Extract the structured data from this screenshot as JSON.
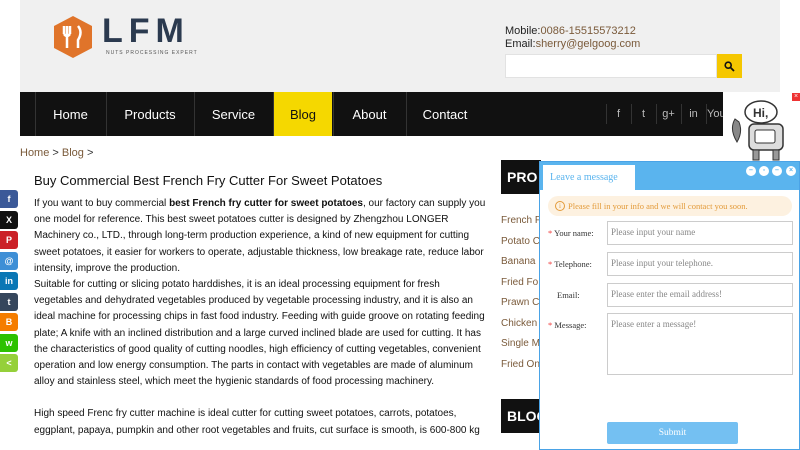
{
  "header": {
    "logo_text": "LFM",
    "logo_sub": "NUTS PROCESSING EXPERT",
    "mobile_label": "Mobile:",
    "mobile_value": "0086-15515573212",
    "email_label": "Email:",
    "email_value": "sherry@gelgoog.com"
  },
  "nav": {
    "items": [
      {
        "label": "Home"
      },
      {
        "label": "Products"
      },
      {
        "label": "Service"
      },
      {
        "label": "Blog"
      },
      {
        "label": "About"
      },
      {
        "label": "Contact"
      }
    ],
    "active": "Blog",
    "social": [
      "f",
      "t",
      "g+",
      "in",
      "You"
    ]
  },
  "breadcrumb": {
    "home": "Home",
    "sep1": " > ",
    "blog": "Blog",
    "sep2": " >"
  },
  "article": {
    "title": "Buy Commercial Best French Fry Cutter For Sweet Potatoes",
    "p1_before": "If you want to buy commercial ",
    "p1_bold": "best French fry cutter for sweet potatoes",
    "p1_after": ", our factory can supply you one model for reference. This best sweet potatoes cutter is designed by Zhengzhou LONGER Machinery co., LTD., through long-term production experience, a kind of new equipment for cutting sweet potatoes, it easier for workers to operate, adjustable thickness, low breakage rate, reduce labor intensity, improve the production.",
    "p2": "Suitable for cutting or slicing potato harddishes, it is an ideal processing equipment for fresh vegetables and dehydrated vegetables produced by vegetable processing industry, and it is also an ideal machine for processing chips in fast food industry. Feeding with guide groove on rotating feeding plate; A knife with an inclined distribution and a large curved inclined blade are used for cutting. It has the characteristics of good quality of cutting noodles, high efficiency of cutting vegetables, convenient operation and low energy consumption. The parts in contact with vegetables are made of aluminum alloy and stainless steel, which meet the hygienic standards of food processing machinery.",
    "p3": "High speed Frenc fry cutter machine is ideal cutter for cutting sweet potatoes, carrots, potatoes, eggplant, papaya, pumpkin and other root vegetables and fruits, cut surface is smooth, is 600-800 kg"
  },
  "sidebar": {
    "products_head": "PRO",
    "items": [
      "French F",
      "Potato C",
      "Banana",
      "Fried Fo",
      "Prawn C",
      "Chicken",
      "Single M",
      "Fried On"
    ],
    "blog_head": "BLOG"
  },
  "share": [
    {
      "icon": "facebook-icon",
      "glyph": "f",
      "color": "#3b5998"
    },
    {
      "icon": "x-icon",
      "glyph": "X",
      "color": "#111111"
    },
    {
      "icon": "pinterest-icon",
      "glyph": "P",
      "color": "#cb2027"
    },
    {
      "icon": "email-icon",
      "glyph": "@",
      "color": "#3e8fd6"
    },
    {
      "icon": "linkedin-icon",
      "glyph": "in",
      "color": "#0a77b5"
    },
    {
      "icon": "tumblr-icon",
      "glyph": "t",
      "color": "#35465c"
    },
    {
      "icon": "blogger-icon",
      "glyph": "B",
      "color": "#f57d00"
    },
    {
      "icon": "wechat-icon",
      "glyph": "w",
      "color": "#2dc100"
    },
    {
      "icon": "share-icon",
      "glyph": "<",
      "color": "#95d03a"
    }
  ],
  "chat": {
    "tab": "Leave a message",
    "notice": "Please fill in your info and we will contact you soon.",
    "name_label": "Your name:",
    "name_placeholder": "Please input your name",
    "phone_label": "Telephone:",
    "phone_placeholder": "Please input your telephone.",
    "email_label": "Email:",
    "email_placeholder": "Please enter the email address!",
    "message_label": "Message:",
    "message_placeholder": "Please enter a message!",
    "submit": "Submit",
    "required_mark": "*"
  },
  "widget": {
    "hi_text": "Hi,"
  },
  "colors": {
    "accent_yellow": "#f5d800",
    "nav_bg": "#111111",
    "chat_blue": "#5ab4ee",
    "link_brown": "#7a5a3a",
    "logo_orange": "#e0742a"
  }
}
